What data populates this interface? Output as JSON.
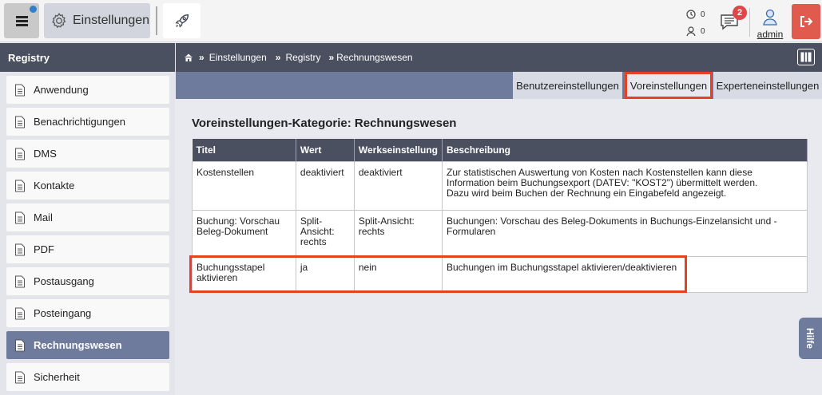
{
  "topbar": {
    "settings_label": "Einstellungen",
    "counter_1": "0",
    "counter_2": "0",
    "messages_badge": "2",
    "user_name": "admin"
  },
  "sidebar": {
    "title": "Registry",
    "items": [
      {
        "label": "Anwendung"
      },
      {
        "label": "Benachrichtigungen"
      },
      {
        "label": "DMS"
      },
      {
        "label": "Kontakte"
      },
      {
        "label": "Mail"
      },
      {
        "label": "PDF"
      },
      {
        "label": "Postausgang"
      },
      {
        "label": "Posteingang"
      },
      {
        "label": "Rechnungswesen",
        "active": true
      },
      {
        "label": "Sicherheit"
      }
    ]
  },
  "breadcrumb": {
    "sep": "»",
    "items": [
      "Einstellungen",
      "Registry",
      "Rechnungswesen"
    ]
  },
  "tabs": [
    {
      "label": "Benutzereinstellungen"
    },
    {
      "label": "Voreinstellungen",
      "selected": true
    },
    {
      "label": "Experteneinstellungen"
    }
  ],
  "main": {
    "title": "Voreinstellungen-Kategorie: Rechnungswesen",
    "columns": [
      "Titel",
      "Wert",
      "Werkseinstellung",
      "Beschreibung"
    ],
    "rows": [
      {
        "titel": "Kostenstellen",
        "wert": "deaktiviert",
        "werk": "deaktiviert",
        "beschreibung_1": "Zur statistischen Auswertung von Kosten nach Kostenstellen kann diese",
        "beschreibung_2": "Information beim Buchungsexport (DATEV: \"KOST2\") übermittelt werden.",
        "beschreibung_3": "Dazu wird beim Buchen der Rechnung ein Eingabefeld angezeigt."
      },
      {
        "titel_1": "Buchung: Vorschau",
        "titel_2": "Beleg-Dokument",
        "wert_1": "Split-",
        "wert_2": "Ansicht:",
        "wert_3": "rechts",
        "werk_1": "Split-Ansicht:",
        "werk_2": "rechts",
        "beschreibung_1": "Buchungen: Vorschau des Beleg-Dokuments in Buchungs-Einzelansicht und -",
        "beschreibung_2": "Formularen"
      },
      {
        "titel_1": "Buchungsstapel",
        "titel_2": "aktivieren",
        "wert": "ja",
        "werk": "nein",
        "beschreibung": "Buchungen im Buchungsstapel aktivieren/deaktivieren"
      }
    ]
  },
  "help_label": "Hilfe",
  "colors": {
    "accent": "#6e7b9d",
    "dark": "#4b5060",
    "highlight": "#e7421f",
    "logout": "#e05a4e",
    "badge": "#e0474c"
  }
}
